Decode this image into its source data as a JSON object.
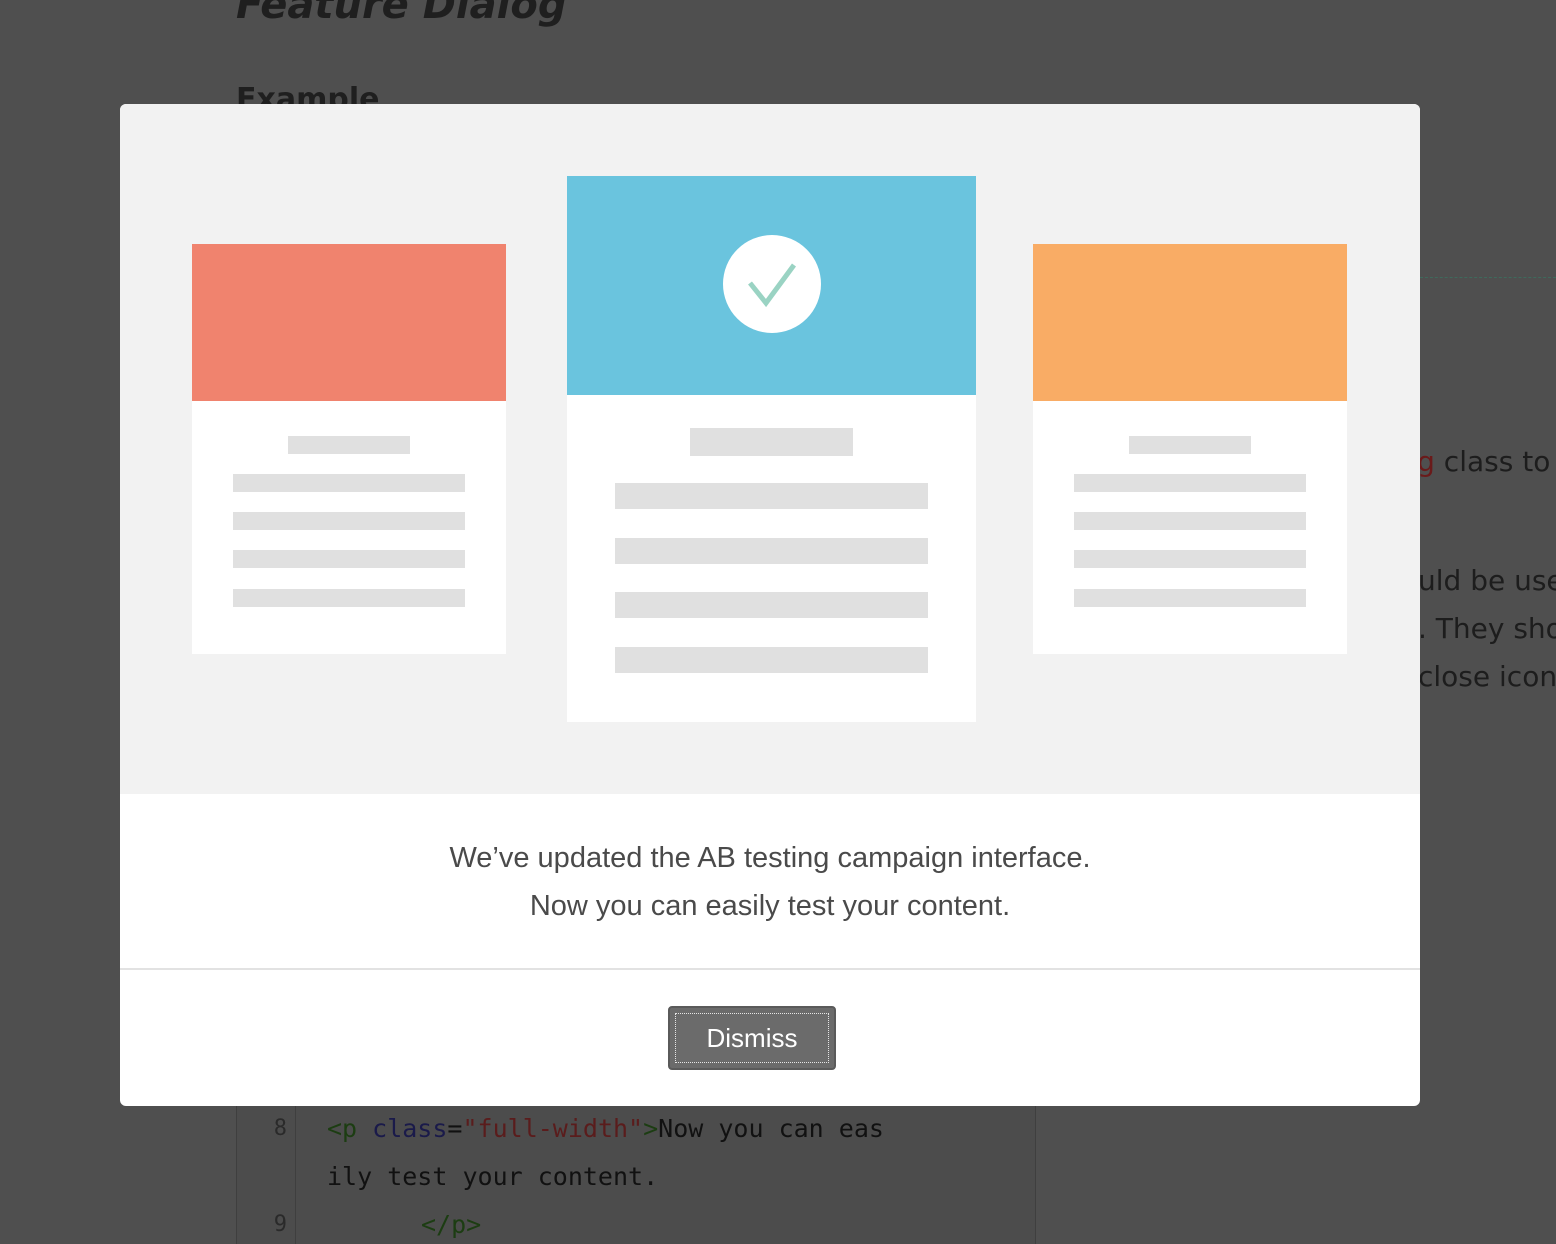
{
  "background_page": {
    "title": "Feature Dialog",
    "subtitle": "Example",
    "right_fragments": {
      "line1_code": "og",
      "line1_text": " class to",
      "line2": "uld be use",
      "line3": ". They sho",
      "line4": "close icon"
    },
    "code_lines": [
      {
        "number": "8",
        "open_tag": "<p ",
        "attr": "class",
        "equals": "=",
        "value": "\"full-width\"",
        "close_bracket": ">",
        "text": "Now you can eas"
      },
      {
        "number": "",
        "text": "ily test your content."
      },
      {
        "number": "9",
        "tag": "</p>"
      }
    ]
  },
  "modal": {
    "hero": {
      "cards": [
        {
          "name": "left",
          "accent": "#f0836e"
        },
        {
          "name": "center",
          "accent": "#6ac4de",
          "icon": "checkmark-icon",
          "icon_color": "#9ad3c3"
        },
        {
          "name": "right",
          "accent": "#f9ac65"
        }
      ],
      "hero_background": "#f2f2f2",
      "placeholder_bar_color": "#e0e0e0"
    },
    "message": {
      "line1": "We’ve updated the AB testing campaign interface.",
      "line2": "Now you can easily test your content."
    },
    "dismiss_label": "Dismiss"
  },
  "colors": {
    "overlay": "#4f4f4f",
    "button": "#6b6b6b",
    "message_text": "#4a4a4a"
  }
}
